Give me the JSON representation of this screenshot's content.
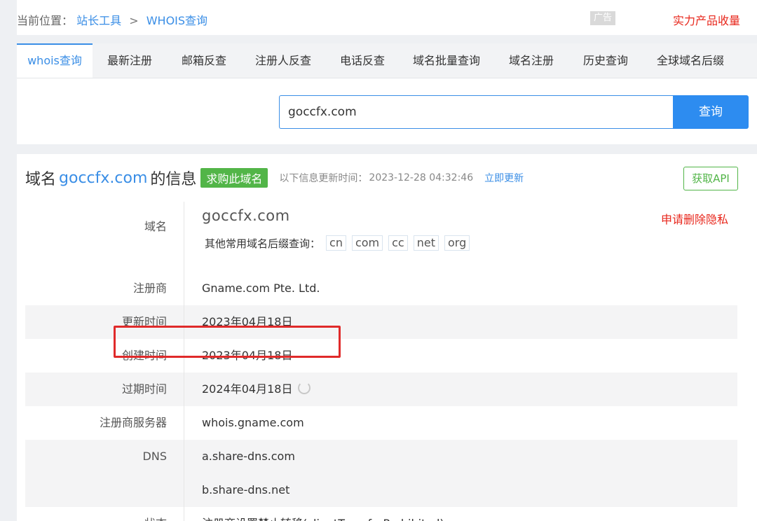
{
  "breadcrumb": {
    "prefix": "当前位置：",
    "parent": "站长工具",
    "separator": ">",
    "current": "WHOIS查询"
  },
  "ad": {
    "badge": "广告",
    "text": "实力产品收量"
  },
  "tabs": [
    {
      "label": "whois查询",
      "active": true
    },
    {
      "label": "最新注册"
    },
    {
      "label": "邮箱反查"
    },
    {
      "label": "注册人反查"
    },
    {
      "label": "电话反查"
    },
    {
      "label": "域名批量查询"
    },
    {
      "label": "域名注册"
    },
    {
      "label": "历史查询"
    },
    {
      "label": "全球域名后缀"
    }
  ],
  "search": {
    "value": "goccfx.com",
    "button": "查询"
  },
  "info": {
    "title_prefix": "域名",
    "domain": "goccfx.com",
    "title_suffix": "的信息",
    "buy_button": "求购此域名",
    "update_label": "以下信息更新时间：",
    "update_time": "2023-12-28 04:32:46",
    "refresh_link": "立即更新",
    "api_button": "获取API"
  },
  "domain_row": {
    "label": "域名",
    "value": "goccfx.com",
    "suffix_label": "其他常用域名后缀查询：",
    "suffixes": [
      "cn",
      "com",
      "cc",
      "net",
      "org"
    ],
    "delete_privacy": "申请删除隐私"
  },
  "rows": {
    "registrar": {
      "label": "注册商",
      "value": "Gname.com Pte. Ltd."
    },
    "updated": {
      "label": "更新时间",
      "value": "2023年04月18日"
    },
    "created": {
      "label": "创建时间",
      "value": "2023年04月18日"
    },
    "expires": {
      "label": "过期时间",
      "value": "2024年04月18日"
    },
    "whois_server": {
      "label": "注册商服务器",
      "value": "whois.gname.com"
    },
    "dns": {
      "label": "DNS",
      "values": [
        "a.share-dns.com",
        "b.share-dns.net"
      ]
    },
    "status": {
      "label": "状态",
      "value": "注册商设置禁止转移(clientTransferProhibited)"
    }
  },
  "colors": {
    "accent": "#3a8ee6",
    "green": "#52b548",
    "red": "#e8271c",
    "highlight": "#e02a2a"
  }
}
